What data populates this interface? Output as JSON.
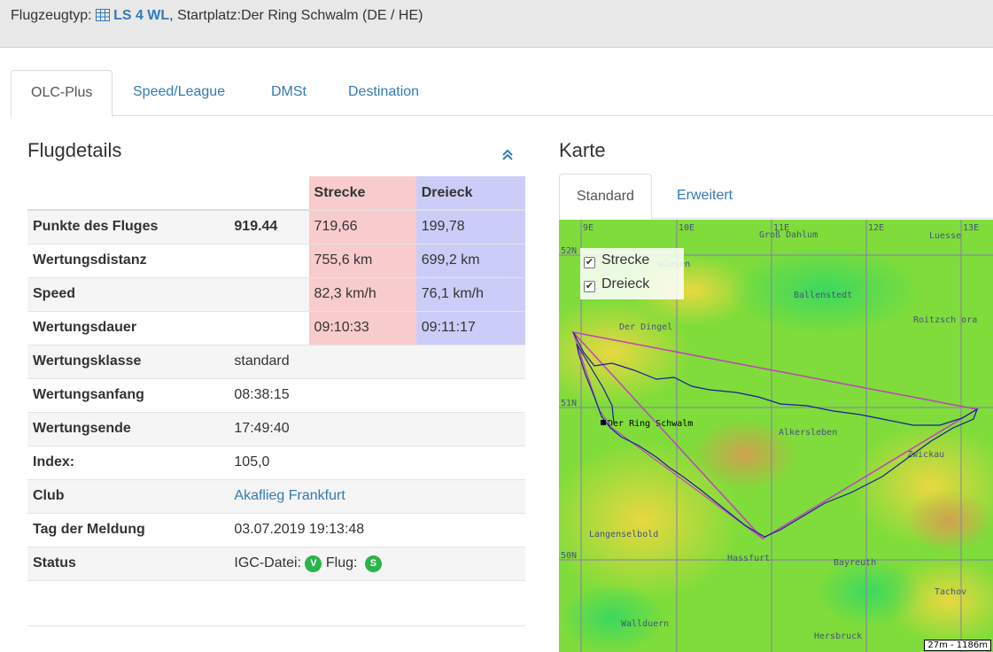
{
  "header": {
    "label_flugzeugtyp": "Flugzeugtyp:",
    "aircraft": "LS 4 WL",
    "startplatz_text": ", Startplatz:Der Ring Schwalm (DE / HE)"
  },
  "tabs": [
    {
      "label": "OLC-Plus",
      "active": true
    },
    {
      "label": "Speed/League"
    },
    {
      "label": "DMSt"
    },
    {
      "label": "Destination"
    }
  ],
  "flugdetails": {
    "title": "Flugdetails",
    "col_strecke": "Strecke",
    "col_dreieck": "Dreieck",
    "rows": [
      {
        "label": "Punkte des Fluges",
        "points": "919.44",
        "strecke": "719,66",
        "dreieck": "199,78"
      },
      {
        "label": "Wertungsdistanz",
        "strecke": "755,6 km",
        "dreieck": "699,2 km"
      },
      {
        "label": "Speed",
        "strecke": "82,3 km/h",
        "dreieck": "76,1 km/h"
      },
      {
        "label": "Wertungsdauer",
        "strecke": "09:10:33",
        "dreieck": "09:11:17"
      },
      {
        "label": "Wertungsklasse",
        "value": "standard"
      },
      {
        "label": "Wertungsanfang",
        "value": "08:38:15"
      },
      {
        "label": "Wertungsende",
        "value": "17:49:40"
      },
      {
        "label": "Index:",
        "value": "105,0"
      },
      {
        "label": "Club",
        "value": "Akaflieg Frankfurt"
      },
      {
        "label": "Tag der Meldung",
        "value": "03.07.2019 19:13:48"
      },
      {
        "label": "Status",
        "igc_label": "IGC-Datei:",
        "igc_badge": "V",
        "flug_label": "Flug:",
        "flug_badge": "S"
      }
    ]
  },
  "karte": {
    "title": "Karte",
    "tabs": [
      {
        "label": "Standard",
        "active": true
      },
      {
        "label": "Erweitert"
      }
    ],
    "legend": [
      {
        "label": "Strecke",
        "checked": true
      },
      {
        "label": "Dreieck",
        "checked": true
      }
    ],
    "lon_labels": [
      "9E",
      "10E",
      "11E",
      "12E",
      "13E"
    ],
    "lat_labels": [
      "52N",
      "51N",
      "50N"
    ],
    "places": [
      "Groß Dahlum",
      "Luesse",
      "wiesen",
      "Ballenstedt",
      "Der Dingel",
      "Roitzsch ora",
      "Der Ring Schwalm",
      "Alkersleben",
      "Zwickau",
      "Langenselbold",
      "Hassfurt",
      "Bayreuth",
      "Tachov",
      "Wallduern",
      "Hersbruck"
    ],
    "scale": "27m - 1186m",
    "colors": {
      "track": "#1a1aa0",
      "triangle": "#c040c0"
    }
  }
}
